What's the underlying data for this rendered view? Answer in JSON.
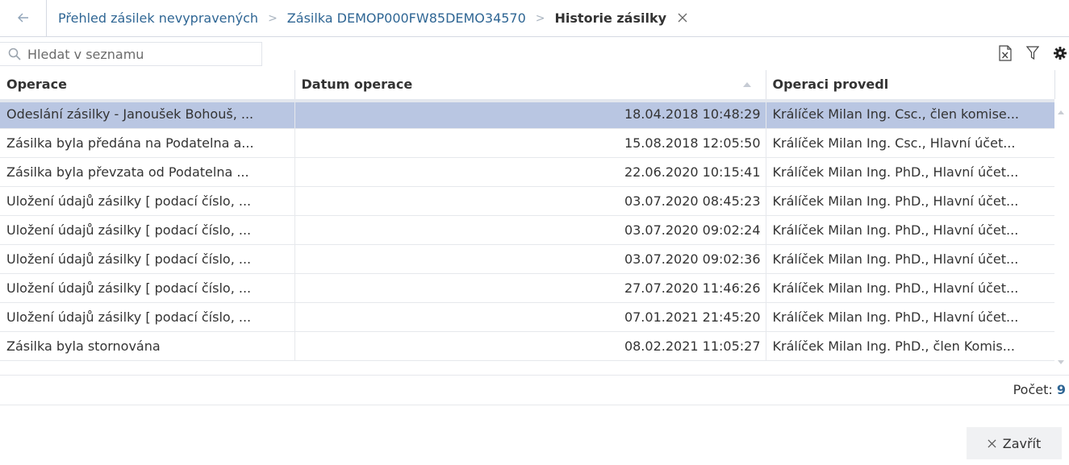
{
  "breadcrumb": {
    "back_icon": "arrow-left-icon",
    "items": [
      "Přehled zásilek nevypravených",
      "Zásilka DEMOP000FW85DEMO34570"
    ],
    "separator": ">",
    "current": "Historie zásilky",
    "close_icon": "close-icon"
  },
  "search": {
    "placeholder": "Hledat v seznamu",
    "value": ""
  },
  "toolbar": {
    "icons": [
      "excel-export-icon",
      "filter-icon",
      "gear-icon"
    ]
  },
  "table": {
    "columns": [
      "Operace",
      "Datum operace",
      "Operaci provedl"
    ],
    "sort": {
      "column": "Datum operace",
      "direction": "ascending"
    },
    "rows": [
      {
        "operation": "Odeslání zásilky - Janoušek Bohouš, ...",
        "date": "18.04.2018 10:48:29",
        "performed_by": "Králíček Milan Ing. Csc., člen komise...",
        "selected": true
      },
      {
        "operation": "Zásilka byla předána na Podatelna a...",
        "date": "15.08.2018 12:05:50",
        "performed_by": "Králíček Milan Ing. Csc., Hlavní účet...",
        "selected": false
      },
      {
        "operation": "Zásilka byla převzata od Podatelna ...",
        "date": "22.06.2020 10:15:41",
        "performed_by": "Králíček Milan Ing. PhD., Hlavní účet...",
        "selected": false
      },
      {
        "operation": "Uložení údajů zásilky [ podací číslo, ...",
        "date": "03.07.2020 08:45:23",
        "performed_by": "Králíček Milan Ing. PhD., Hlavní účet...",
        "selected": false
      },
      {
        "operation": "Uložení údajů zásilky [ podací číslo, ...",
        "date": "03.07.2020 09:02:24",
        "performed_by": "Králíček Milan Ing. PhD., Hlavní účet...",
        "selected": false
      },
      {
        "operation": "Uložení údajů zásilky [ podací číslo, ...",
        "date": "03.07.2020 09:02:36",
        "performed_by": "Králíček Milan Ing. PhD., Hlavní účet...",
        "selected": false
      },
      {
        "operation": "Uložení údajů zásilky [ podací číslo, ...",
        "date": "27.07.2020 11:46:26",
        "performed_by": "Králíček Milan Ing. PhD., Hlavní účet...",
        "selected": false
      },
      {
        "operation": "Uložení údajů zásilky [ podací číslo, ...",
        "date": "07.01.2021 21:45:20",
        "performed_by": "Králíček Milan Ing. PhD., Hlavní účet...",
        "selected": false
      },
      {
        "operation": "Zásilka byla stornována",
        "date": "08.02.2021 11:05:27",
        "performed_by": "Králíček Milan Ing. PhD., člen Komis...",
        "selected": false
      }
    ]
  },
  "footer": {
    "count_label": "Počet:",
    "count_value": "9"
  },
  "close_button": {
    "label": "Zavřít",
    "icon": "close-icon"
  },
  "colors": {
    "link": "#2f6694",
    "selected_row": "#b9c6e2",
    "border": "#dfe2e8"
  }
}
